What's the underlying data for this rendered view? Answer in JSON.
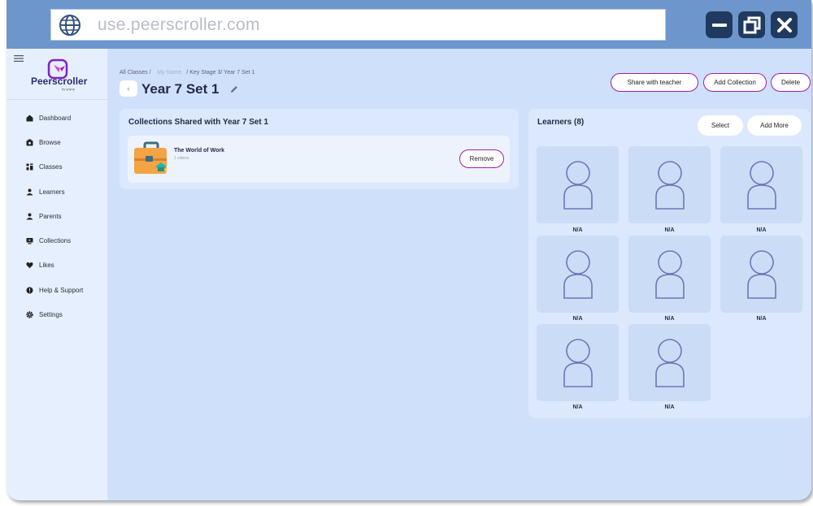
{
  "browser": {
    "url": "use.peerscroller.com"
  },
  "sidebar": {
    "brand": "Peerscroller",
    "brand_sub": "by yoyop",
    "items": [
      {
        "label": "Dashboard",
        "icon": "home-icon"
      },
      {
        "label": "Browse",
        "icon": "browse-icon"
      },
      {
        "label": "Classes",
        "icon": "classes-icon"
      },
      {
        "label": "Learners",
        "icon": "learners-icon"
      },
      {
        "label": "Parents",
        "icon": "parents-icon"
      },
      {
        "label": "Collections",
        "icon": "collections-icon"
      },
      {
        "label": "Likes",
        "icon": "heart-icon"
      },
      {
        "label": "Help & Support",
        "icon": "help-icon"
      },
      {
        "label": "Settings",
        "icon": "gear-icon"
      }
    ]
  },
  "header": {
    "breadcrumb_start": "All Classes /",
    "breadcrumb_muted": "My Name",
    "breadcrumb_end": "/ Key Stage 3/ Year 7 Set 1",
    "title": "Year 7 Set 1",
    "share_label": "Share with teacher",
    "add_collection_label": "Add Collection",
    "delete_label": "Delete"
  },
  "collections": {
    "title": "Collections Shared with Year 7 Set 1",
    "items": [
      {
        "name": "The World of Work",
        "sub": "1 videos",
        "remove_label": "Remove"
      }
    ]
  },
  "learners": {
    "title": "Learners (8)",
    "select_label": "Select",
    "add_more_label": "Add More",
    "items": [
      {
        "name": "N/A"
      },
      {
        "name": "N/A"
      },
      {
        "name": "N/A"
      },
      {
        "name": "N/A"
      },
      {
        "name": "N/A"
      },
      {
        "name": "N/A"
      },
      {
        "name": "N/A"
      },
      {
        "name": "N/A"
      }
    ]
  },
  "colors": {
    "accent": "#a21caf",
    "brand_purple": "#7e22ce",
    "chrome": "#6d97cc",
    "window_button": "#203a5f"
  }
}
